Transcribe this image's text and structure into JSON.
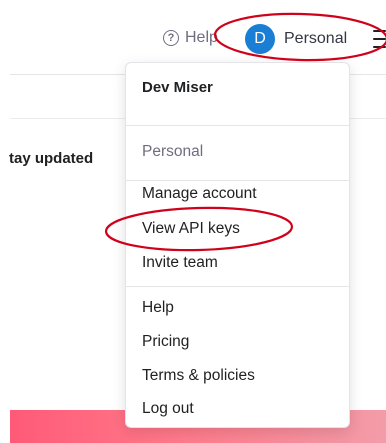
{
  "topbar": {
    "help_icon_glyph": "?",
    "help_label": "Help",
    "avatar_initial": "D",
    "account_label": "Personal",
    "avatar_color": "#1a7fd4"
  },
  "background": {
    "heading_text": "tay updated"
  },
  "dropdown": {
    "user_name": "Dev Miser",
    "org_label": "Personal",
    "group1": [
      "Manage account",
      "View API keys",
      "Invite team"
    ],
    "group2": [
      "Help",
      "Pricing",
      "Terms & policies",
      "Log out"
    ]
  },
  "annotations": {
    "color": "#d0021b"
  }
}
